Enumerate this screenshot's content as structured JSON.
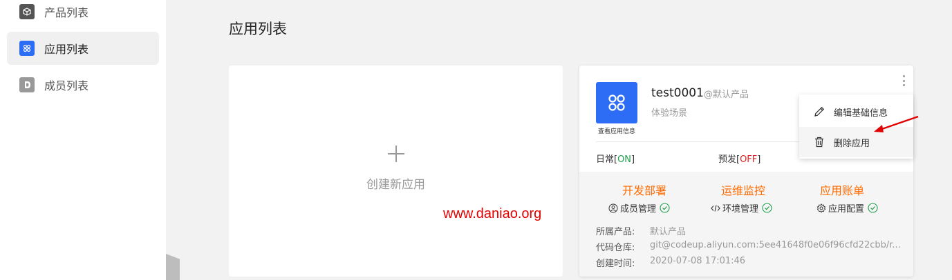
{
  "sidebar": {
    "items": [
      {
        "label": "产品列表",
        "icon": "cube-icon",
        "active": false
      },
      {
        "label": "应用列表",
        "icon": "app-grid-icon",
        "active": true
      },
      {
        "label": "成员列表",
        "icon": "members-icon",
        "active": false
      }
    ]
  },
  "page": {
    "title": "应用列表"
  },
  "create_card": {
    "label": "创建新应用",
    "icon": "plus-icon"
  },
  "watermark": "www.daniao.org",
  "app_card": {
    "name": "test0001",
    "product_tag": "@默认产品",
    "scene": "体验场景",
    "logo_caption": "查看应用信息",
    "environments": [
      {
        "label": "日常[",
        "status": "ON",
        "suffix": "]"
      },
      {
        "label": "预发[",
        "status": "OFF",
        "suffix": "]"
      }
    ],
    "sections": [
      {
        "title": "开发部署",
        "link": "成员管理",
        "icon": "user-circle-icon"
      },
      {
        "title": "运维监控",
        "link": "环境管理",
        "icon": "code-icon"
      },
      {
        "title": "应用账单",
        "link": "应用配置",
        "icon": "settings-icon"
      }
    ],
    "info": [
      {
        "label": "所属产品:",
        "value": "默认产品"
      },
      {
        "label": "代码仓库:",
        "value": "git@codeup.aliyun.com:5ee41648f0e06f96cfd22cbb/r..."
      },
      {
        "label": "创建时间:",
        "value": "2020-07-08 17:01:46"
      }
    ]
  },
  "context_menu": {
    "items": [
      {
        "label": "编辑基础信息",
        "icon": "pencil-icon"
      },
      {
        "label": "删除应用",
        "icon": "trash-icon"
      }
    ]
  },
  "colors": {
    "accent": "#2d6df6",
    "orange": "#ff6a00",
    "on": "#1e9e4a",
    "off": "#e02020",
    "annotation": "#e00000"
  }
}
